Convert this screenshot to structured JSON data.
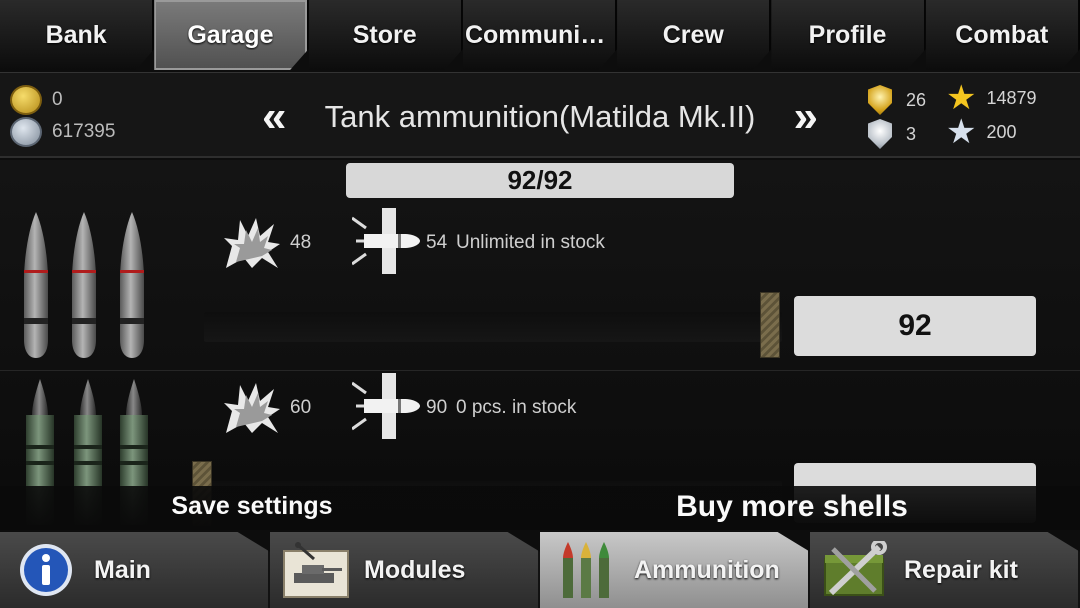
{
  "top_tabs": [
    {
      "label": "Bank"
    },
    {
      "label": "Garage"
    },
    {
      "label": "Store"
    },
    {
      "label": "Communic..."
    },
    {
      "label": "Crew"
    },
    {
      "label": "Profile"
    },
    {
      "label": "Combat"
    }
  ],
  "active_top_tab": "Garage",
  "header": {
    "gold": "0",
    "silver": "617395",
    "title": "Tank ammunition(Matilda Mk.II)",
    "prev_chevron": "«",
    "next_chevron": "»",
    "stats": {
      "gold_badge": "26",
      "silver_badge": "3",
      "gold_stars": "14879",
      "silver_stars": "200"
    }
  },
  "ammo": {
    "capacity_text": "92/92",
    "rows": [
      {
        "shell_type": "armor-piercing",
        "damage": "48",
        "penetration": "54",
        "stock": "Unlimited in stock",
        "quantity": "92"
      },
      {
        "shell_type": "high-explosive",
        "damage": "60",
        "penetration": "90",
        "stock": "0 pcs. in stock",
        "quantity": ""
      }
    ]
  },
  "actions": {
    "save": "Save settings",
    "buy": "Buy more shells"
  },
  "bottom_tabs": [
    {
      "label": "Main",
      "icon": "info-icon"
    },
    {
      "label": "Modules",
      "icon": "tank-blueprint-icon"
    },
    {
      "label": "Ammunition",
      "icon": "shells-icon"
    },
    {
      "label": "Repair kit",
      "icon": "wrench-kit-icon"
    }
  ],
  "active_bottom_tab": "Ammunition",
  "colors": {
    "gold": "#d4a21a",
    "silver": "#b9c0c8",
    "active_tab": "#7b7b7b"
  }
}
